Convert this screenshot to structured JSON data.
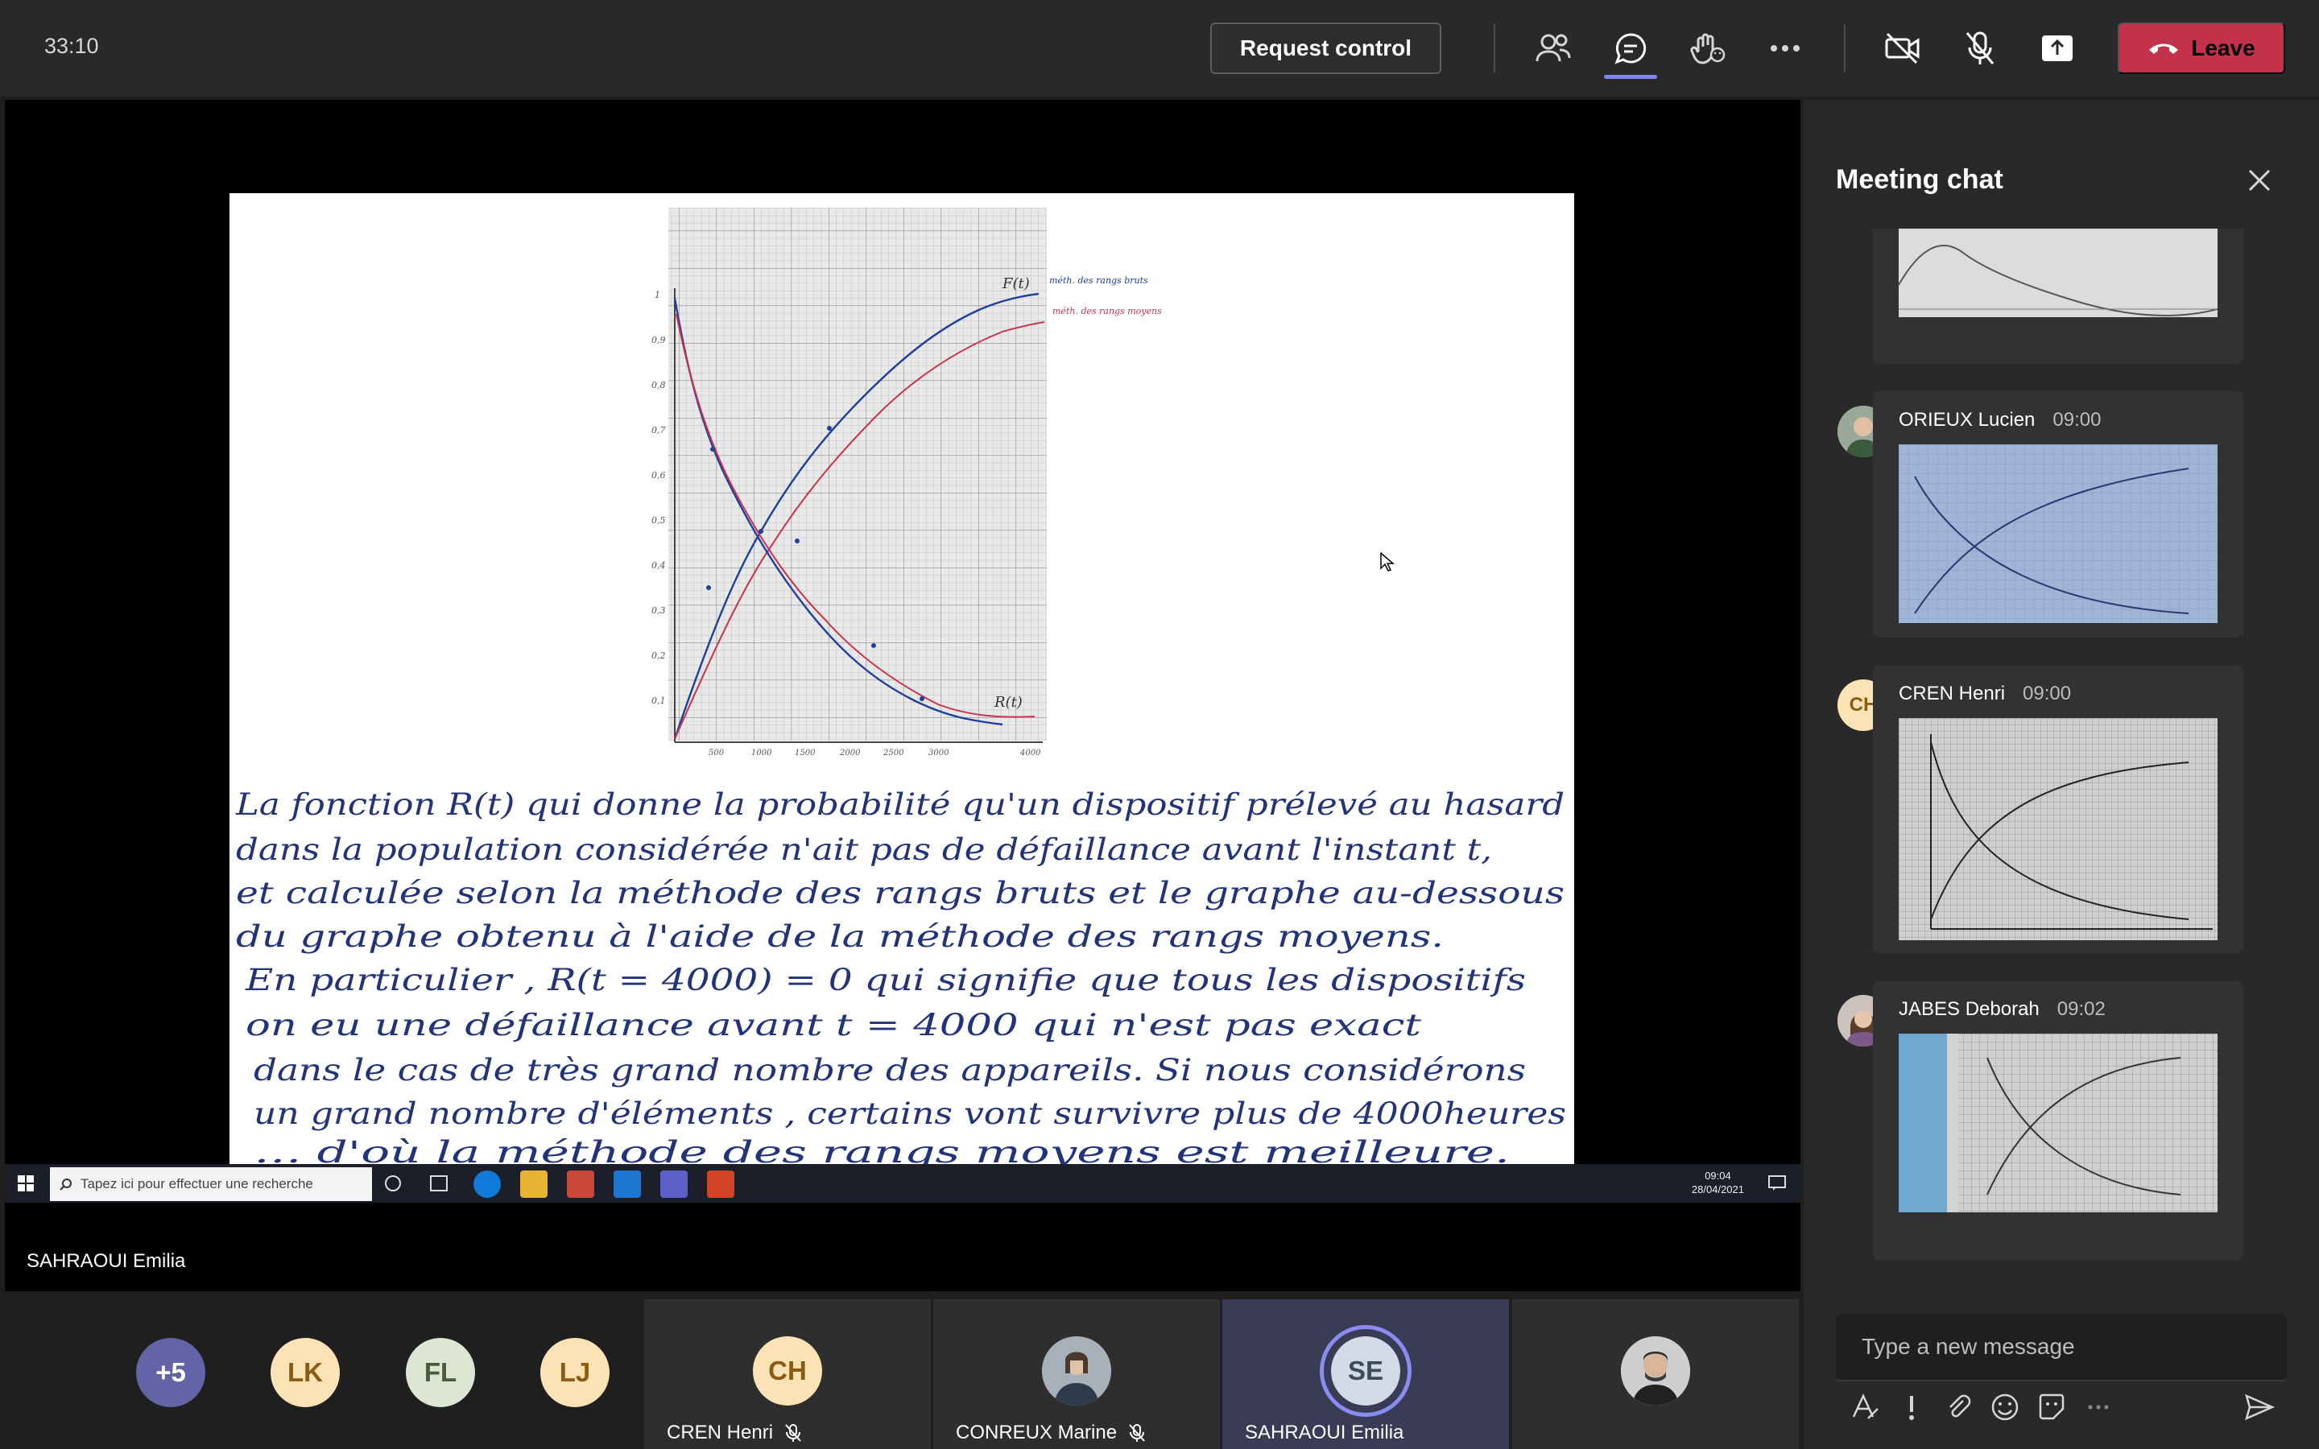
{
  "topbar": {
    "timer": "33:10",
    "request_control": "Request control",
    "leave": "Leave"
  },
  "slide": {
    "chart": {
      "curve_label_F": "F(t)",
      "curve_label_R": "R(t)",
      "legend_brut": "méth. des rangs bruts",
      "legend_moyen": "méth. des rangs moyens",
      "y_ticks": [
        "1",
        "0,9",
        "0,8",
        "0,7",
        "0,6",
        "0,5",
        "0,4",
        "0,3",
        "0,2",
        "0,1"
      ],
      "x_ticks": [
        "500",
        "1000",
        "1500",
        "2000",
        "2500",
        "3000",
        "4000"
      ]
    },
    "handwriting": [
      "La fonction R(t) qui donne la probabilité qu'un dispositif prélevé au hasard",
      "dans la population considérée n'ait pas de défaillance avant l'instant t,",
      "et calculée selon la méthode des rangs bruts et le graphe au-dessous",
      "du graphe obtenu à l'aide de la méthode des rangs moyens.",
      "En particulier , R(t = 4000) = 0 qui signifie que tous les dispositifs",
      "on eu une défaillance avant t = 4000 qui n'est pas exact",
      "dans le cas de très grand nombre des appareils. Si nous considérons",
      "un grand nombre d'éléments , certains vont survivre plus de 4000heures",
      "… d'où la méthode des rangs moyens est meilleure."
    ]
  },
  "taskbar": {
    "search_placeholder": "Tapez ici pour effectuer une recherche",
    "time": "09:04",
    "date": "28/04/2021"
  },
  "presenter_name": "SAHRAOUI Emilia",
  "gallery": {
    "overflow": "+5",
    "avatars": [
      {
        "initials": "LK"
      },
      {
        "initials": "FL"
      },
      {
        "initials": "LJ"
      }
    ],
    "tiles": [
      {
        "initials": "CH",
        "name": "CREN Henri"
      },
      {
        "initials": "",
        "name": "CONREUX Marine"
      },
      {
        "initials": "SE",
        "name": "SAHRAOUI Emilia"
      },
      {
        "initials": "",
        "name": ""
      }
    ]
  },
  "chat": {
    "title": "Meeting chat",
    "messages": [
      {
        "author": "ORIEUX Lucien",
        "time": "09:00"
      },
      {
        "author": "CREN Henri",
        "time": "09:00",
        "initials": "CH"
      },
      {
        "author": "JABES Deborah",
        "time": "09:02"
      }
    ],
    "compose_placeholder": "Type a new message"
  },
  "colors": {
    "accent": "#7f85f5",
    "leave": "#c4314b",
    "ink_blue": "#1f3f9e",
    "ink_red": "#c8344a",
    "grid": "#a7a7a7"
  }
}
